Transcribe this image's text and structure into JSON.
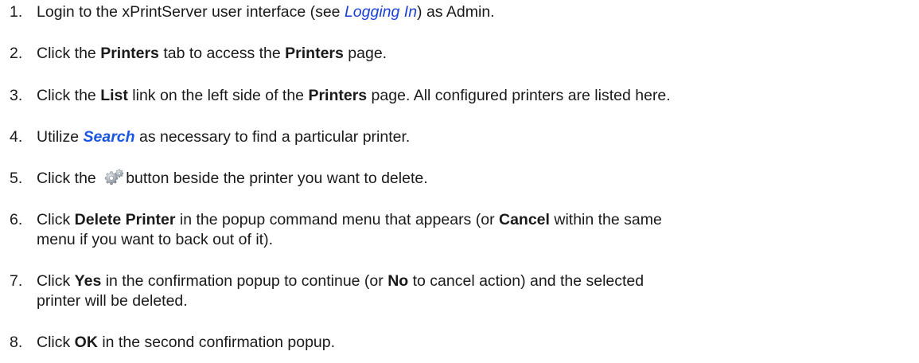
{
  "steps": [
    {
      "number": "1.",
      "parts": [
        "Login to the xPrintServer user interface (see ",
        "Logging In",
        ") as Admin."
      ]
    },
    {
      "number": "2.",
      "parts": [
        "Click the ",
        "Printers",
        " tab to access the ",
        "Printers",
        " page."
      ]
    },
    {
      "number": "3.",
      "parts": [
        "Click the ",
        "List",
        " link on the left side of the ",
        "Printers",
        " page. All configured printers are listed here."
      ]
    },
    {
      "number": "4.",
      "parts": [
        "Utilize ",
        "Search",
        " as necessary to find a particular printer."
      ]
    },
    {
      "number": "5.",
      "parts": [
        "Click the ",
        "button beside the printer you want to delete."
      ],
      "icon": "gear-icon"
    },
    {
      "number": "6.",
      "parts": [
        "Click ",
        "Delete Printer",
        " in the popup command menu that appears (or ",
        "Cancel",
        " within the same",
        "menu if you want to back out of it)."
      ]
    },
    {
      "number": "7.",
      "parts": [
        "Click ",
        "Yes",
        " in the confirmation popup to continue (or ",
        "No",
        " to cancel action) and the selected",
        "printer will be deleted."
      ]
    },
    {
      "number": "8.",
      "parts": [
        "Click ",
        "OK",
        " in the second confirmation popup."
      ]
    }
  ],
  "colors": {
    "link": "#1a3fd6",
    "link_bold": "#1a56e0",
    "text": "#1a1a1a"
  }
}
